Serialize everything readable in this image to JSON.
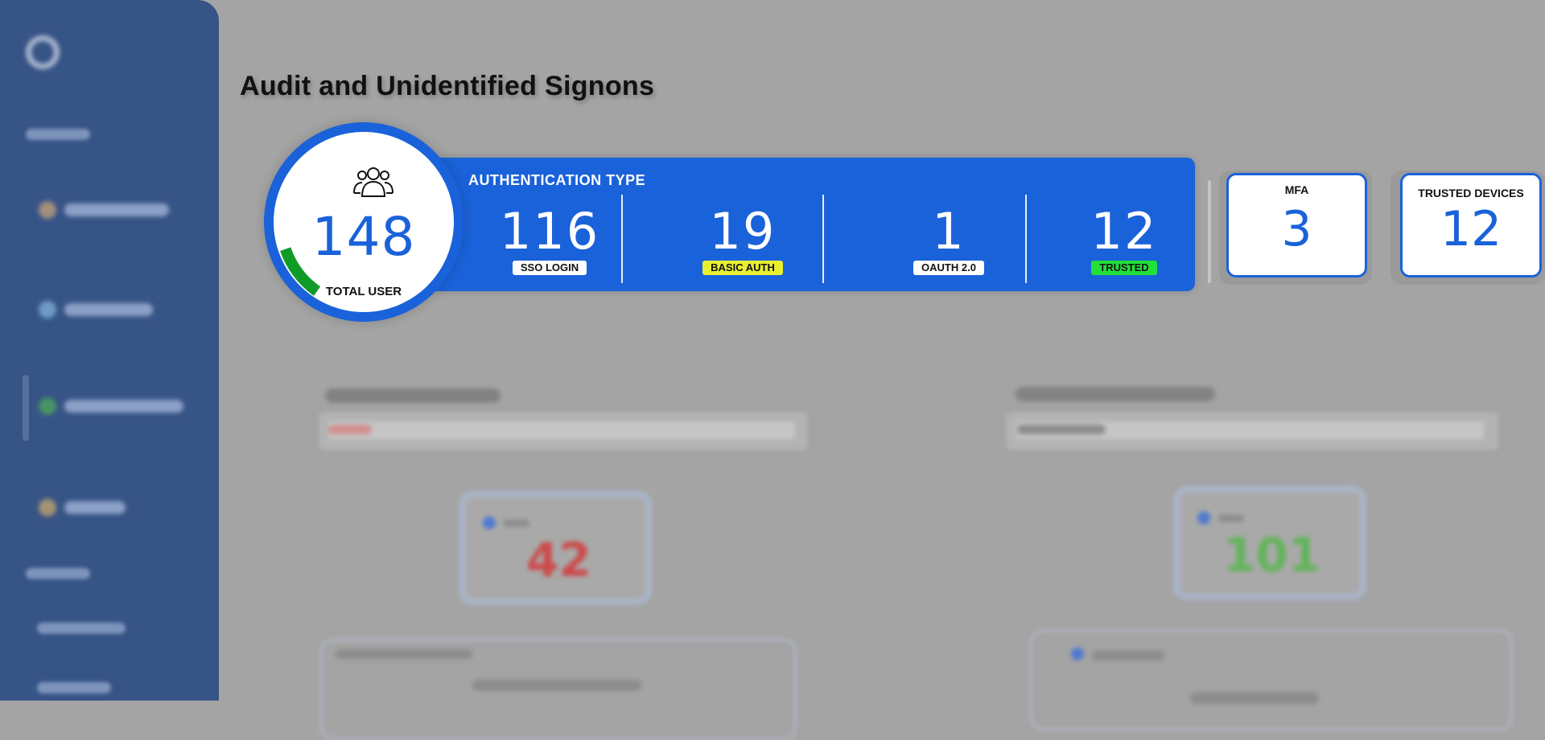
{
  "page_title": "Audit and Unidentified Signons",
  "total_user": {
    "value": "148",
    "label": "TOTAL USER",
    "icon": "users-icon"
  },
  "authentication": {
    "title": "AUTHENTICATION TYPE",
    "items": [
      {
        "value": "116",
        "label": "SSO LOGIN",
        "badge_color": "#ffffff"
      },
      {
        "value": "19",
        "label": "BASIC AUTH",
        "badge_color": "#e8f030"
      },
      {
        "value": "1",
        "label": "OAUTH 2.0",
        "badge_color": "#ffffff"
      },
      {
        "value": "12",
        "label": "TRUSTED",
        "badge_color": "#22e03a"
      }
    ]
  },
  "cards": [
    {
      "label": "MFA",
      "value": "3"
    },
    {
      "label": "TRUSTED DEVICES",
      "value": "12"
    }
  ],
  "background_stats": [
    {
      "value": "42",
      "color": "#cc4a4a"
    },
    {
      "value": "101",
      "color": "#62b45a"
    }
  ],
  "colors": {
    "accent": "#1a62d9",
    "sidebar": "#375486",
    "overlay": "#a4a4a4",
    "arc": "#109a28"
  }
}
